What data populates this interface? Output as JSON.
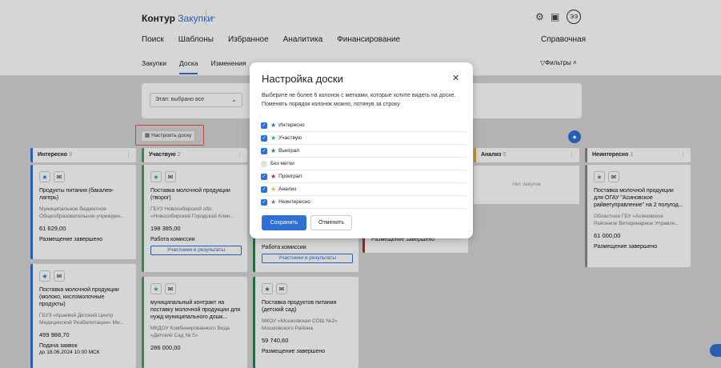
{
  "header": {
    "logo_brand": "Контур",
    "logo_product": "Закупки",
    "nav": [
      "Поиск",
      "Шаблоны",
      "Избранное",
      "Аналитика",
      "Финансирование"
    ],
    "reference": "Справочная",
    "avatar": "ЭЭ",
    "subnav": [
      {
        "label": "Закупки",
        "active": false
      },
      {
        "label": "Доска",
        "active": true
      },
      {
        "label": "Изменения",
        "active": false
      }
    ],
    "filters_label": "Фильтры"
  },
  "filter_panel": {
    "stage_select_value": "Этап: выбрано все"
  },
  "board_settings_button": "Настроить доску",
  "columns": [
    {
      "title": "Интересно",
      "count": "3",
      "color": "#2f6fd6"
    },
    {
      "title": "Участвую",
      "count": "2",
      "color": "#3aa56b"
    },
    {
      "title": "Анализ",
      "count": "0",
      "color": "#e8a84a"
    },
    {
      "title": "Неинтересно",
      "count": "1",
      "color": "#888888"
    }
  ],
  "cards": {
    "interest_1": {
      "title": "Продукты питания (бакалея-лагерь)",
      "org": "Муниципальное бюджетное Общеобразовательное учрежден...",
      "price": "61 629,00",
      "status": "Размещение завершено"
    },
    "interest_2": {
      "title": "Поставка молочной продукции (молоко, кисломолочные продукты)",
      "org": "ГБУЗ «Краевой Детский Центр Медицинской Реабилитации» Ми...",
      "price": "499 988,70",
      "status": "Подача заявок",
      "status2": "до 18.06.2024 10:00 МСК"
    },
    "participate_1": {
      "title": "Поставка молочной продукции (творог)",
      "org": "ГБУЗ Новосибирской обл. «Новосибирский Городской Клин...",
      "price": "198 385,00",
      "status": "Работа комиссии",
      "button": "Участники и результаты"
    },
    "participate_2": {
      "title": "муниципальный контракт на поставку молочной продукции для нужд муниципального дошк...",
      "org": "МКДОУ Комбинированного Вида «Детский Сад № 5»",
      "price": "286 000,00"
    },
    "win_1": {
      "status": "Работа комиссии",
      "button": "Участники и результаты"
    },
    "win_2": {
      "title": "Поставка продуктов питания (детский сад)",
      "org": "МКОУ «Мошковская СОШ №2» Мошковского Района",
      "price": "59 740,60",
      "status": "Размещение завершено"
    },
    "lost_1": {
      "status": "Размещение завершено"
    },
    "analysis_empty": "Нет закупок",
    "notint_1": {
      "title": "Поставка молочной продукции для ОГАУ \"Асиновское райветуправление\" на 2 полугод...",
      "org": "Областное ГБУ «Асиновское Районное Ветеринарное Управле...",
      "price": "61 000,00",
      "status": "Размещение завершено"
    }
  },
  "modal": {
    "title": "Настройка доски",
    "description": "Выберите не более 6 колонок с метками, которые хотите видеть на доске. Поменять порядок колонок можно, потянув за строку",
    "options": [
      {
        "label": "Интересно",
        "checked": true,
        "star_color": "#2f6fd6"
      },
      {
        "label": "Участвую",
        "checked": true,
        "star_color": "#3aa56b"
      },
      {
        "label": "Выиграл",
        "checked": true,
        "star_color": "#2e7d4f"
      },
      {
        "label": "Без метки",
        "checked": false,
        "star_color": ""
      },
      {
        "label": "Проиграл",
        "checked": true,
        "star_color": "#b03030"
      },
      {
        "label": "Анализ",
        "checked": true,
        "star_color": "#e8a84a"
      },
      {
        "label": "Неинтересно",
        "checked": true,
        "star_color": "#777777"
      }
    ],
    "save_label": "Сохранить",
    "cancel_label": "Отменить"
  }
}
